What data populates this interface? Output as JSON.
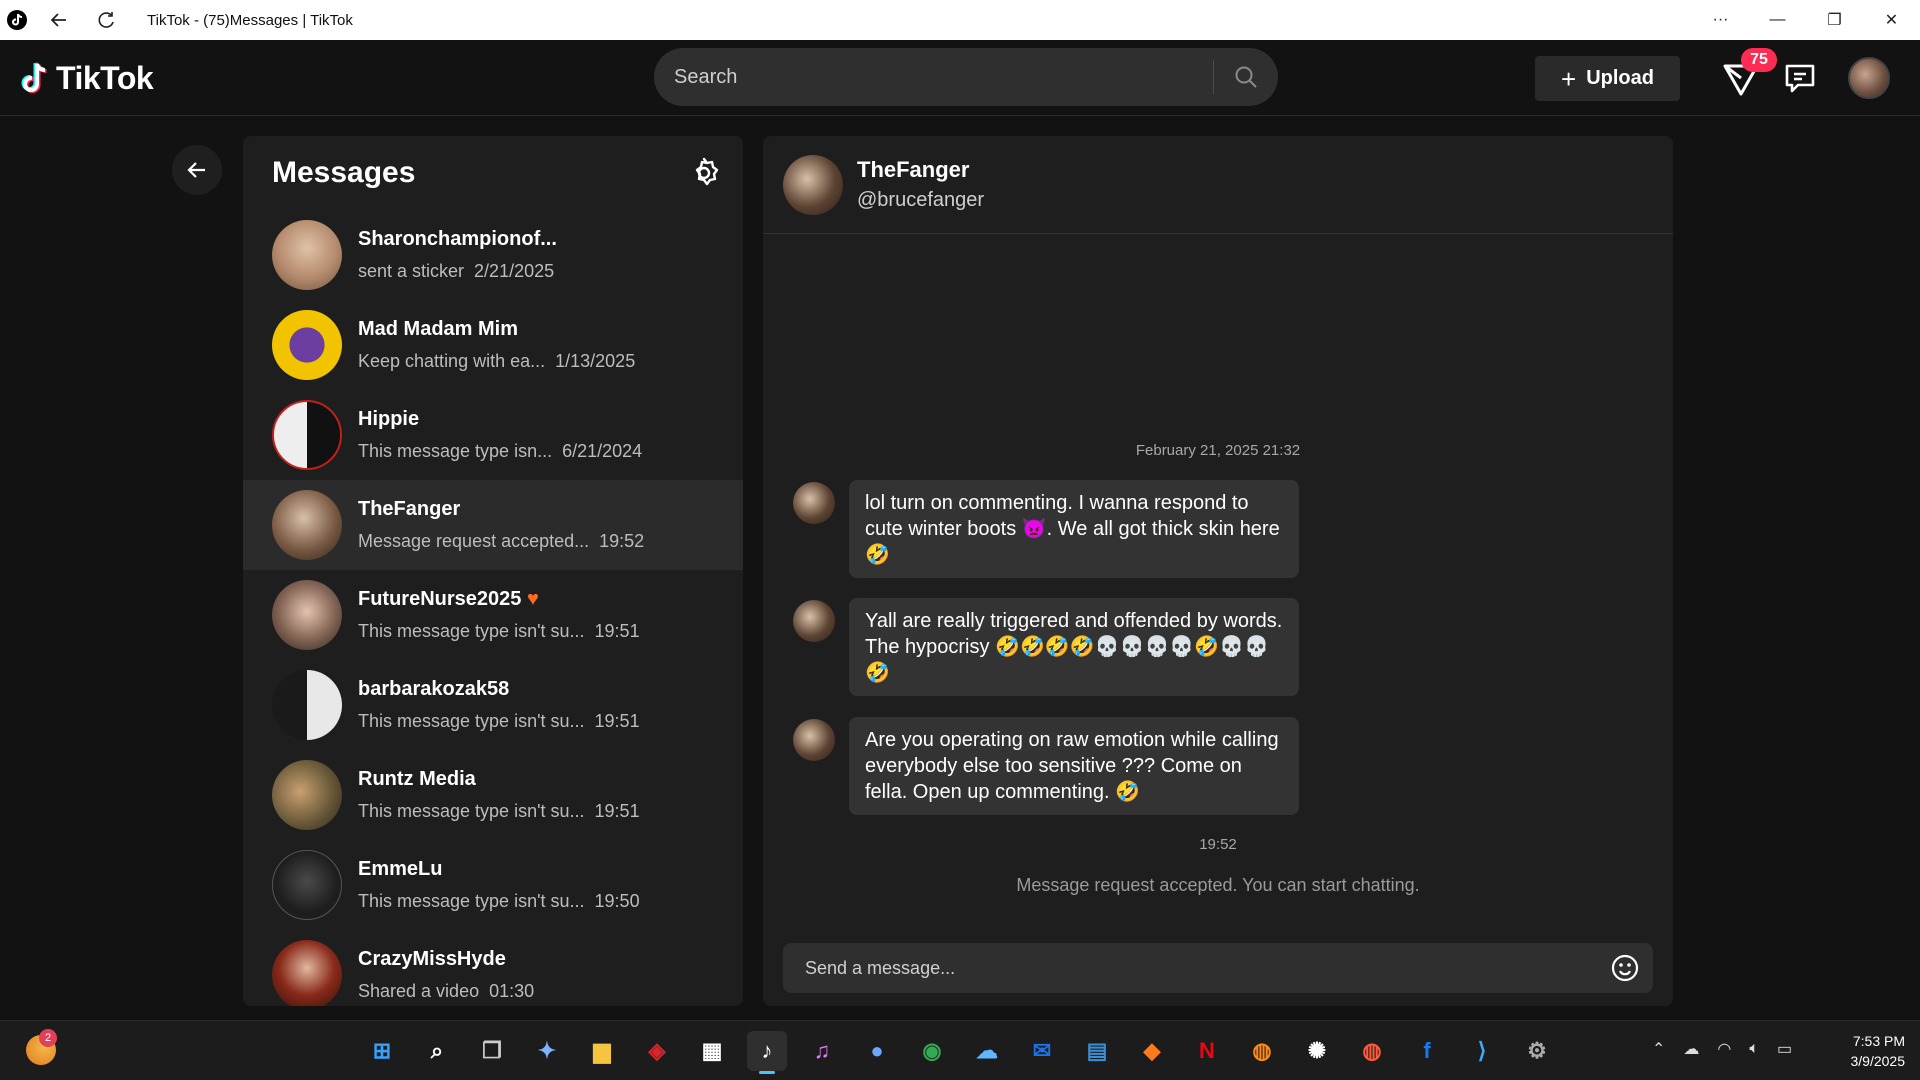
{
  "window": {
    "title": "TikTok - (75)Messages | TikTok"
  },
  "header": {
    "logo_text": "TikTok",
    "search_placeholder": "Search",
    "upload_label": "Upload",
    "inbox_badge": "75"
  },
  "messages_panel": {
    "title": "Messages",
    "conversations": [
      {
        "name": "Sharonchampionof...",
        "preview": "sent a sticker",
        "time": "2/21/2025",
        "avatar_color": "#b48a6c"
      },
      {
        "name": "Mad Madam Mim",
        "preview": "Keep chatting with ea...",
        "time": "1/13/2025",
        "avatar_color": "#f2c400"
      },
      {
        "name": "Hippie",
        "preview": "This message type isn...",
        "time": "6/21/2024",
        "avatar_color": "#e8e8e8"
      },
      {
        "name": "TheFanger",
        "preview": "Message request accepted...",
        "time": "19:52",
        "avatar_color": "#7a5a44"
      },
      {
        "name": "FutureNurse2025",
        "preview": "This message type isn't su...",
        "time": "19:51",
        "avatar_color": "#8a6a5a"
      },
      {
        "name": "barbarakozak58",
        "preview": "This message type isn't su...",
        "time": "19:51",
        "avatar_color": "#555555"
      },
      {
        "name": "Runtz Media",
        "preview": "This message type isn't su...",
        "time": "19:51",
        "avatar_color": "#6b5a3a"
      },
      {
        "name": "EmmeLu",
        "preview": "This message type isn't su...",
        "time": "19:50",
        "avatar_color": "#3a3a3a"
      },
      {
        "name": "CrazyMissHyde",
        "preview": "Shared a video",
        "time": "01:30",
        "avatar_color": "#8a2a1a"
      }
    ]
  },
  "chat": {
    "name": "TheFanger",
    "handle": "@brucefanger",
    "date_stamp": "February 21, 2025 21:32",
    "messages": [
      "lol turn on commenting. I wanna respond to cute winter boots 👿. We all got thick skin here 🤣",
      "Yall are really triggered and offended by words. The hypocrisy 🤣🤣🤣🤣💀💀💀💀🤣💀💀🤣",
      "Are you operating on raw emotion while calling everybody else too sensitive ??? Come on fella.  Open up commenting. 🤣"
    ],
    "time_stamp": "19:52",
    "system_note": "Message request accepted. You can start chatting.",
    "composer_placeholder": "Send a message..."
  },
  "taskbar": {
    "weather_badge": "2",
    "time": "7:53 PM",
    "date": "3/9/2025"
  },
  "colors": {
    "accent": "#fe2c55",
    "bubble": "#333333",
    "panel": "#1e1e1e",
    "background": "#121212"
  }
}
